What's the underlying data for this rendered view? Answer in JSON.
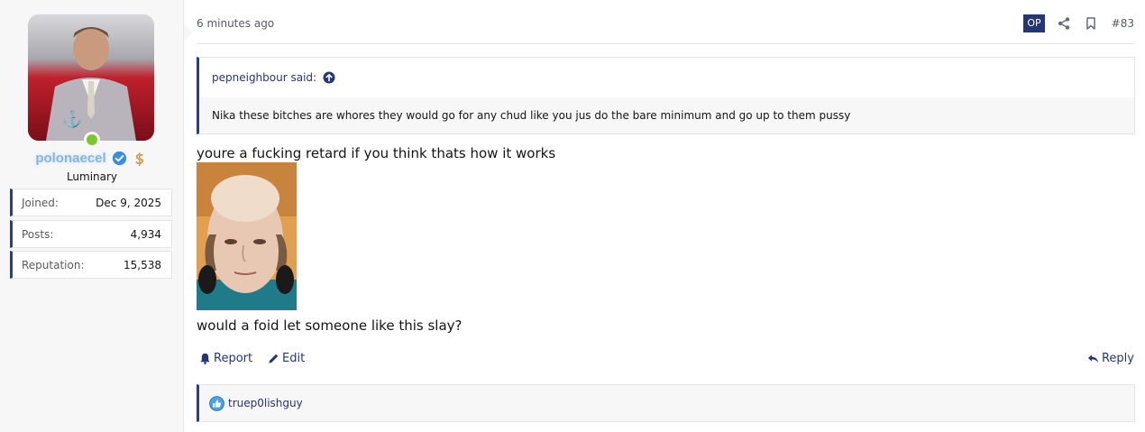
{
  "user": {
    "username": "polonaecel",
    "title": "Luminary",
    "stats": [
      {
        "label": "Joined:",
        "value": "Dec 9, 2025"
      },
      {
        "label": "Posts:",
        "value": "4,934"
      },
      {
        "label": "Reputation:",
        "value": "15,538"
      }
    ],
    "avatar_icon": "man-in-suit-avatar",
    "online_color": "#7ac82a"
  },
  "post": {
    "time": "6 minutes ago",
    "op_badge": "OP",
    "number": "#83",
    "quote": {
      "author": "pepneighbour said:",
      "text": "Nika these bitches are whores they would go for any chud like you jus do the bare minimum and go up to them pussy"
    },
    "text1": "youre a fucking retard if you think thats how it works",
    "text2": "would a foid let someone like this slay?",
    "image_icon": "bald-woman-photo"
  },
  "actions": {
    "report": "Report",
    "edit": "Edit",
    "reply": "Reply"
  },
  "reactions": {
    "user": "truep0lishguy",
    "icon": "like-icon"
  },
  "colors": {
    "accent": "#263672",
    "border_accent": "#2f3f7a",
    "sidebar_bg": "#f7f7f8"
  }
}
